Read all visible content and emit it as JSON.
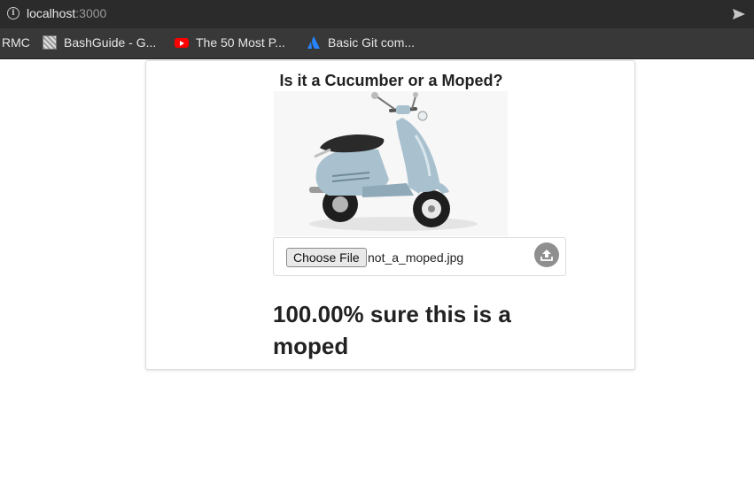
{
  "browser": {
    "url_host": "localhost",
    "url_port": ":3000",
    "icons": {
      "info": "info-icon",
      "send": "send-icon"
    }
  },
  "bookmarks": [
    {
      "label": "RMC",
      "icon": ""
    },
    {
      "label": "BashGuide - G...",
      "icon": "bashguide-favicon"
    },
    {
      "label": "The 50 Most P...",
      "icon": "youtube-icon"
    },
    {
      "label": "Basic Git com...",
      "icon": "atlassian-icon"
    }
  ],
  "page": {
    "title": "Is it a Cucumber or a Moped?",
    "image_subject": "moped",
    "upload": {
      "button_label": "Choose File",
      "file_name": "not_a_moped.jpg",
      "upload_icon": "upload-icon"
    },
    "result_text": "100.00% sure this is a moped"
  },
  "colors": {
    "chrome_bg": "#2b2b2b",
    "bookmarks_bg": "#383838",
    "upload_icon_bg": "#8f8f8f",
    "moped_body": "#a9c1cf"
  }
}
